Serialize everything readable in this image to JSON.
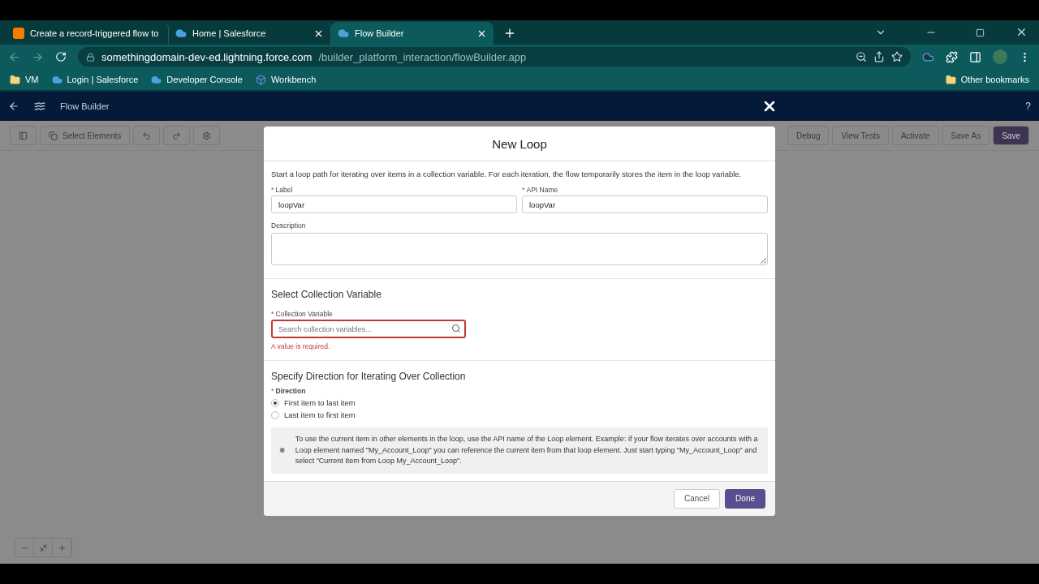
{
  "browser": {
    "tabs": [
      {
        "title": "Create a record-triggered flow to",
        "selected": false
      },
      {
        "title": "Home | Salesforce",
        "selected": false
      },
      {
        "title": "Flow Builder",
        "selected": true
      }
    ],
    "url_host": "somethingdomain-dev-ed.lightning.force.com",
    "url_path": "/builder_platform_interaction/flowBuilder.app",
    "bookmarks": [
      {
        "label": "VM"
      },
      {
        "label": "Login | Salesforce"
      },
      {
        "label": "Developer Console"
      },
      {
        "label": "Workbench"
      }
    ],
    "other_bookmarks": "Other bookmarks"
  },
  "app_header": {
    "title": "Flow Builder",
    "help": "?"
  },
  "toolbar": {
    "select_elements": "Select Elements",
    "right_buttons": [
      "Debug",
      "View Tests",
      "Activate",
      "Save As",
      "Save"
    ]
  },
  "modal": {
    "title": "New Loop",
    "intro": "Start a loop path for iterating over items in a collection variable. For each iteration, the flow temporarily stores the item in the loop variable.",
    "label_field": {
      "required_mark": "*",
      "label": "Label",
      "value": "loopVar"
    },
    "api_field": {
      "required_mark": "*",
      "label": "API Name",
      "value": "loopVar"
    },
    "description_field": {
      "label": "Description"
    },
    "collection_section": "Select Collection Variable",
    "collection_field": {
      "required_mark": "*",
      "label": "Collection Variable",
      "placeholder": "Search collection variables...",
      "error": "A value is required."
    },
    "direction_section": "Specify Direction for Iterating Over Collection",
    "direction_field": {
      "required_mark": "*",
      "label": "Direction"
    },
    "directions": [
      {
        "label": "First item to last item",
        "selected": true
      },
      {
        "label": "Last item to first item",
        "selected": false
      }
    ],
    "info": "To use the current item in other elements in the loop, use the API name of the Loop element. Example: if your flow iterates over accounts with a Loop element named \"My_Account_Loop\" you can reference the current item from that loop element. Just start typing \"My_Account_Loop\" and select \"Current Item from Loop My_Account_Loop\".",
    "buttons": [
      "Cancel",
      "Done"
    ]
  }
}
